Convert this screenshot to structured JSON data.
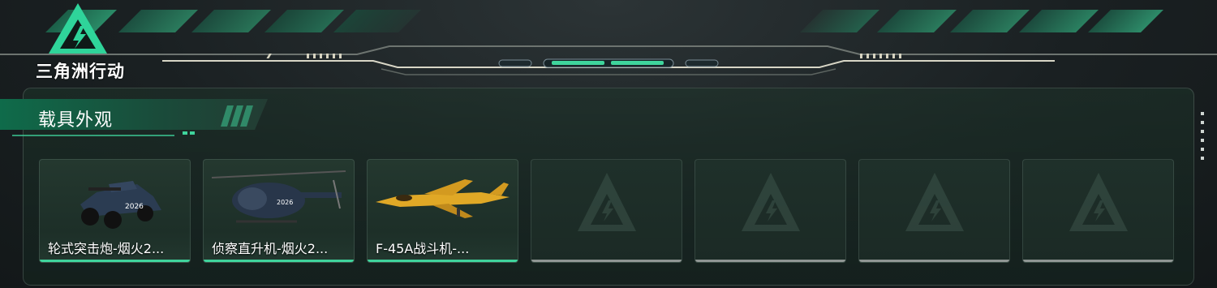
{
  "brand": {
    "title": "三角洲行动"
  },
  "section": {
    "title": "载具外观"
  },
  "cards": [
    {
      "label": "轮式突击炮-烟火2...",
      "filled": true
    },
    {
      "label": "侦察直升机-烟火2...",
      "filled": true
    },
    {
      "label": "F-45A战斗机-...",
      "filled": true
    },
    {
      "label": "",
      "filled": false
    },
    {
      "label": "",
      "filled": false
    },
    {
      "label": "",
      "filled": false
    },
    {
      "label": "",
      "filled": false
    }
  ],
  "colors": {
    "accent": "#3fd49c",
    "empty_bar": "#8f9693",
    "background": "#1a2022"
  }
}
